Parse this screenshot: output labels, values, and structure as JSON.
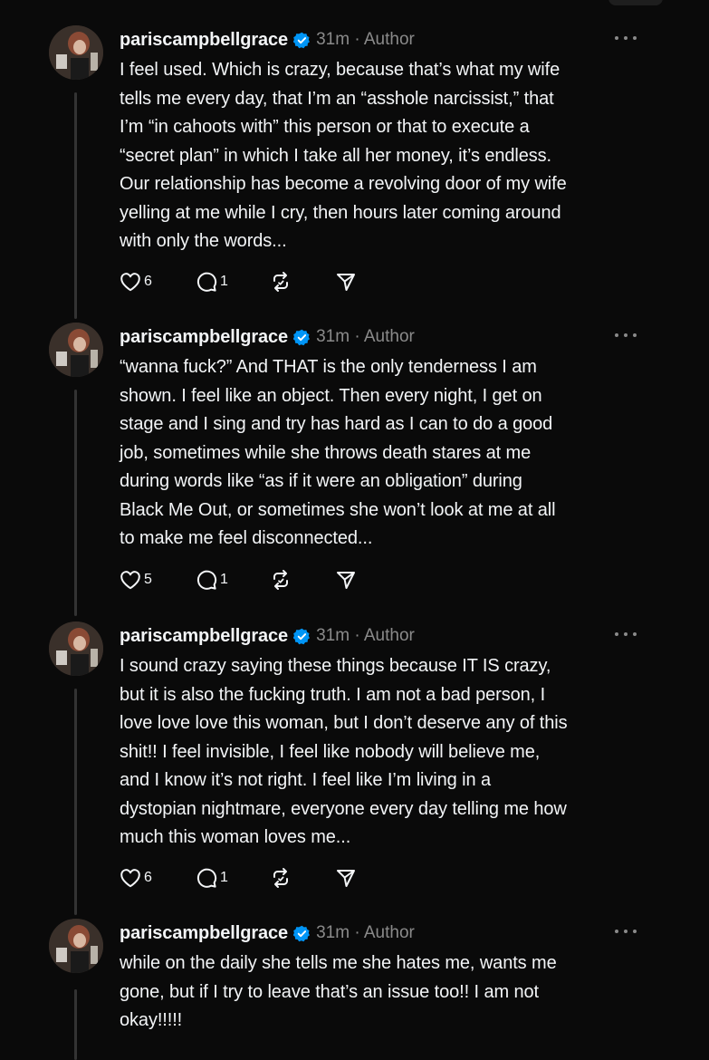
{
  "colors": {
    "background": "#0a0a0a",
    "text": "#f3f5f7",
    "muted": "#8a8a8a",
    "verified": "#0095f6",
    "thread_line": "#333333"
  },
  "icons": {
    "like": "heart-icon",
    "reply": "comment-icon",
    "repost": "repost-icon",
    "share": "send-icon",
    "more": "more-icon",
    "verified": "verified-badge-icon"
  },
  "posts": [
    {
      "username": "pariscampbellgrace",
      "meta": "31m · Author",
      "lines": [
        "I feel used. Which is crazy, because that’s what my wife",
        "tells me every day, that I’m an “asshole narcissist,” that",
        "I’m “in cahoots with” this person or that to execute a",
        "“secret plan” in which I take all her money, it’s endless.",
        "Our relationship has become a revolving door of my wife",
        "yelling at me while I cry, then hours later coming around",
        "with only the words..."
      ],
      "likes": "6",
      "replies": "1"
    },
    {
      "username": "pariscampbellgrace",
      "meta": "31m · Author",
      "lines": [
        "“wanna fuck?” And THAT is the only tenderness I am",
        "shown. I feel like an object. Then every night, I get on",
        "stage and I sing and try has hard as I can to do a good",
        "job, sometimes while she throws death stares at me",
        "during words like “as if it were an obligation” during",
        "Black Me Out, or sometimes she won’t look at me at all",
        "to make me feel disconnected..."
      ],
      "likes": "5",
      "replies": "1"
    },
    {
      "username": "pariscampbellgrace",
      "meta": "31m · Author",
      "lines": [
        "I sound crazy saying these things because IT IS crazy,",
        "but it is also the fucking truth. I am not a bad person, I",
        "love love love this woman, but I don’t deserve any of this",
        "shit!! I feel invisible, I feel like nobody will believe me,",
        "and I know it’s not right. I feel like I’m living in a",
        "dystopian nightmare, everyone every day telling me how",
        "much this woman loves me..."
      ],
      "likes": "6",
      "replies": "1"
    },
    {
      "username": "pariscampbellgrace",
      "meta": "31m · Author",
      "lines": [
        "while on the daily she tells me she hates me, wants me",
        "gone, but if I try to leave that’s an issue too!! I am not",
        "okay!!!!!"
      ],
      "likes": "",
      "replies": ""
    }
  ]
}
